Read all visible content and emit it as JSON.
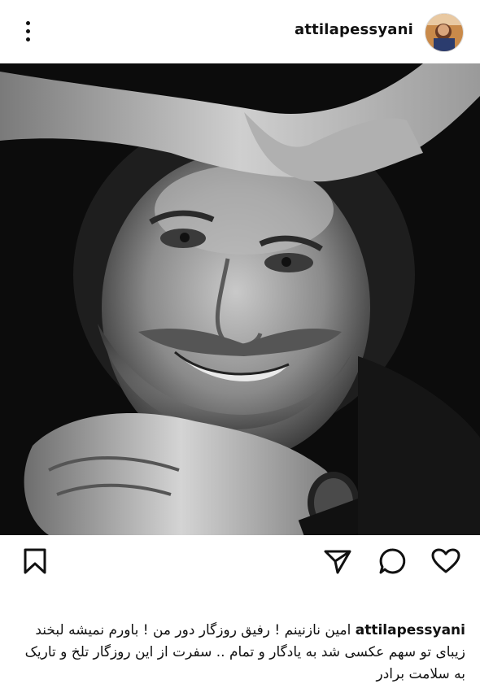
{
  "post": {
    "username": "attilapessyani",
    "caption_username": "attilapessyani",
    "caption_text": "امین نازنینم ! رفیق روزگار دور من ! باورم نمیشه لبخند زیبای تو سهم عکسی شد به یادگار و تمام .. سفرت از این روزگار تلخ و تاریک به سلامت برادر"
  },
  "icons": {
    "more": "more-vertical-icon",
    "bookmark": "bookmark-icon",
    "share": "send-icon",
    "comment": "comment-icon",
    "like": "heart-icon"
  },
  "colors": {
    "background": "#ffffff",
    "text": "#111111",
    "photo_bg": "#0c0c0c"
  }
}
